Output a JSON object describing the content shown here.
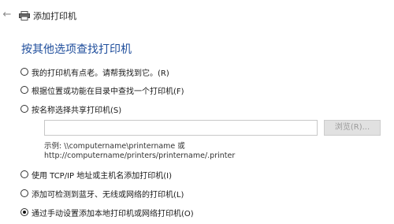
{
  "window": {
    "back_glyph": "←",
    "title": "添加打印机"
  },
  "heading": "按其他选项查找打印机",
  "options": [
    {
      "label": "我的打印机有点老。请帮我找到它。(R)",
      "checked": false
    },
    {
      "label": "根据位置或功能在目录中查找一个打印机(F)",
      "checked": false
    },
    {
      "label": "按名称选择共享打印机(S)",
      "checked": false
    },
    {
      "label": "使用 TCP/IP 地址或主机名添加打印机(I)",
      "checked": false
    },
    {
      "label": "添加可检测到蓝牙、无线或网络的打印机(L)",
      "checked": false
    },
    {
      "label": "通过手动设置添加本地打印机或网络打印机(O)",
      "checked": true
    }
  ],
  "share": {
    "input_value": "",
    "browse_label": "浏览(R)...",
    "example_line1": "示例: \\\\computername\\printername 或",
    "example_line2": "http://computername/printers/printername/.printer"
  },
  "colors": {
    "heading": "#1f4e9c",
    "disabled_button_bg": "#e1e1e1"
  },
  "icons": {
    "back": "back-arrow-icon",
    "app": "printer-icon"
  }
}
